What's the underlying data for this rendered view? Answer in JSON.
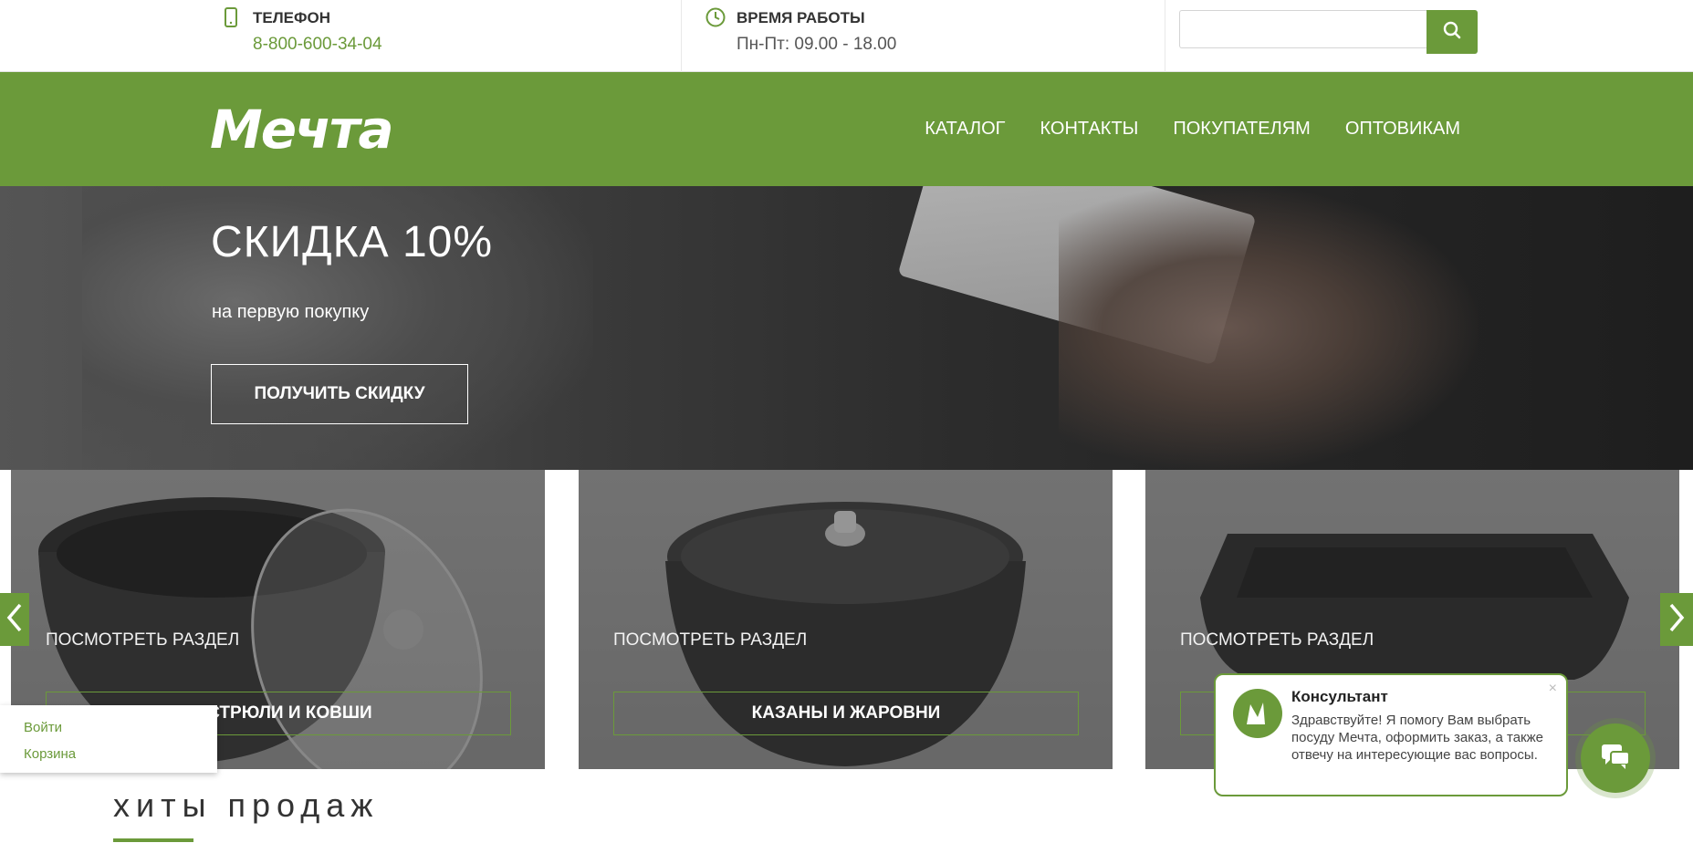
{
  "topbar": {
    "phone_title": "ТЕЛЕФОН",
    "phone_value": "8-800-600-34-04",
    "hours_title": "ВРЕМЯ РАБОТЫ",
    "hours_value": "Пн-Пт: 09.00 - 18.00",
    "search_placeholder": ""
  },
  "header": {
    "logo_text": "Мечта",
    "nav": [
      "КАТАЛОГ",
      "КОНТАКТЫ",
      "ПОКУПАТЕЛЯМ",
      "ОПТОВИКАМ"
    ]
  },
  "hero": {
    "title": "СКИДКА 10%",
    "subtitle": "на первую покупку",
    "button": "ПОЛУЧИТЬ СКИДКУ"
  },
  "tiles": [
    {
      "view_label": "ПОСМОТРЕТЬ РАЗДЕЛ",
      "caption": "КАСТРЮЛИ И КОВШИ"
    },
    {
      "view_label": "ПОСМОТРЕТЬ РАЗДЕЛ",
      "caption": "КАЗАНЫ И ЖАРОВНИ"
    },
    {
      "view_label": "ПОСМОТРЕТЬ РАЗДЕЛ",
      "caption": ""
    }
  ],
  "user_menu": {
    "login": "Войти",
    "cart": "Корзина"
  },
  "section": {
    "title": "хиты продаж"
  },
  "consultant": {
    "name": "Консультант",
    "message": "Здравствуйте! Я помогу Вам выбрать посуду Мечта, оформить заказ, а также отвечу на интересующие вас вопросы.",
    "close": "×"
  },
  "colors": {
    "brand_green": "#6b9a3a"
  }
}
